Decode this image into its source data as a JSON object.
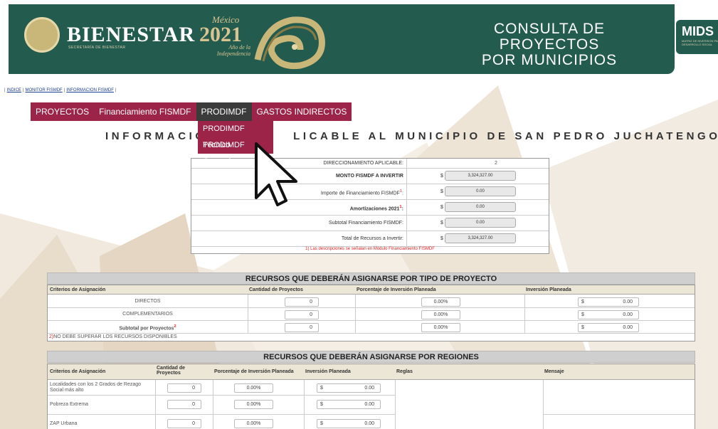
{
  "header": {
    "brand": "BIENESTAR",
    "brand_sub": "SECRETARÍA DE BIENESTAR",
    "mexico_word": "México",
    "year": "2021",
    "year_caption_1": "Año de la",
    "year_caption_2": "Independencia",
    "title_line1": "CONSULTA DE PROYECTOS",
    "title_line2": "POR MUNICIPIOS",
    "mids": "MIDS",
    "mids_sub": "MATRIZ DE INVERSIÓN PARA EL DESARROLLO SOCIAL",
    "colors": {
      "banner": "#235b4e",
      "accent": "#9d2449"
    }
  },
  "breadcrumb": [
    "INDICE",
    "MONITOR FISMDF",
    "INFORMACION FISMDF"
  ],
  "menu": {
    "items": [
      "PROYECTOS",
      "Financiamiento FISMDF",
      "PRODIMDF",
      "GASTOS INDIRECTOS"
    ],
    "active": "PRODIMDF",
    "submenu": [
      "PRODIMDF Técnico",
      "PRODIMDF General"
    ]
  },
  "heading": "INFORMACIÓN APLICABLE AL MUNICIPIO DE SAN PEDRO JUCHATENGO",
  "heading_visible_left": "INFORMACIÓN",
  "heading_visible_right": "LICABLE AL MUNICIPIO DE SAN PEDRO JUCHATENGO",
  "financing": {
    "rows": [
      {
        "label": "DIRECCIONAMIENTO APLICABLE:",
        "currency": "",
        "value": "2"
      },
      {
        "label": "MONTO FISMDF A INVERTIR",
        "currency": "$",
        "value": "3,324,327.00"
      },
      {
        "label": "Importe de Financiamiento FISMDF",
        "sup": "1",
        "label_end": ":",
        "currency": "$",
        "value": "0.00"
      },
      {
        "label": "Amortizaciones 2021",
        "sup": "1",
        "label_end": ":",
        "currency": "$",
        "value": "0.00"
      },
      {
        "label": "Subtotal Financiamiento FISMDF:",
        "currency": "$",
        "value": "0.00"
      },
      {
        "label": "Total de Recursos a Invertir:",
        "currency": "$",
        "value": "3,324,327.00"
      }
    ],
    "note": "1) Las descripciones se señalan en Módulo Financiamiento FISMDF"
  },
  "by_type": {
    "title": "RECURSOS QUE DEBERÁN ASIGNARSE POR TIPO DE PROYECTO",
    "headers": [
      "Criterios de Asignación",
      "Cantidad de Proyectos",
      "Porcentaje de Inversión Planeada",
      "Inversión Planeada"
    ],
    "rows": [
      {
        "label": "DIRECTOS",
        "count": "0",
        "pct": "0.00%",
        "cur": "$",
        "amount": "0.00"
      },
      {
        "label": "COMPLEMENTARIOS",
        "count": "0",
        "pct": "0.00%",
        "cur": "$",
        "amount": "0.00"
      },
      {
        "label": "Subtotal por Proyectos",
        "sup": "2",
        "count": "0",
        "pct": "0.00%",
        "cur": "$",
        "amount": "0.00"
      }
    ],
    "note_num": "2)",
    "note": "NO DEBE SUPERAR LOS RECURSOS DISPONIBLES"
  },
  "by_region": {
    "title": "RECURSOS QUE DEBERÁN ASIGNARSE POR REGIONES",
    "headers": [
      "Criterios de Asignación",
      "Cantidad de Proyectos",
      "Porcentaje de Inversión Planeada",
      "Inversión Planeada",
      "Reglas",
      "Mensaje"
    ],
    "rows": [
      {
        "label": "Localidades con los 2 Grados de Rezago Social más alto",
        "count": "0",
        "pct": "0.00%",
        "cur": "$",
        "amount": "0.00"
      },
      {
        "label": "Pobreza Extrema",
        "count": "0",
        "pct": "0.00%",
        "cur": "$",
        "amount": "0.00"
      },
      {
        "label": "ZAP Urbana",
        "count": "0",
        "pct": "0.00%",
        "cur": "$",
        "amount": "0.00"
      }
    ]
  }
}
